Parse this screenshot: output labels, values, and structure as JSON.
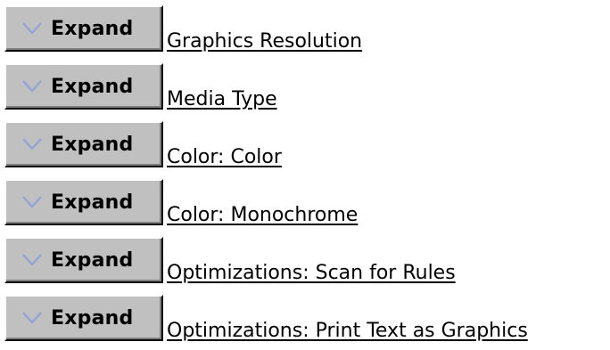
{
  "rows": [
    {
      "button_label": "Expand",
      "icon": "chevron-down-icon",
      "link_text": "Graphics Resolution"
    },
    {
      "button_label": "Expand",
      "icon": "chevron-down-icon",
      "link_text": "Media Type"
    },
    {
      "button_label": "Expand",
      "icon": "chevron-down-icon",
      "link_text": "Color: Color"
    },
    {
      "button_label": "Expand",
      "icon": "chevron-down-icon",
      "link_text": "Color: Monochrome"
    },
    {
      "button_label": "Expand",
      "icon": "chevron-down-icon",
      "link_text": "Optimizations: Scan for Rules"
    },
    {
      "button_label": "Expand",
      "icon": "chevron-down-icon",
      "link_text": "Optimizations: Print Text as Graphics"
    }
  ],
  "colors": {
    "button_face": "#c0c0c0",
    "chevron": "#8ea4d6"
  }
}
